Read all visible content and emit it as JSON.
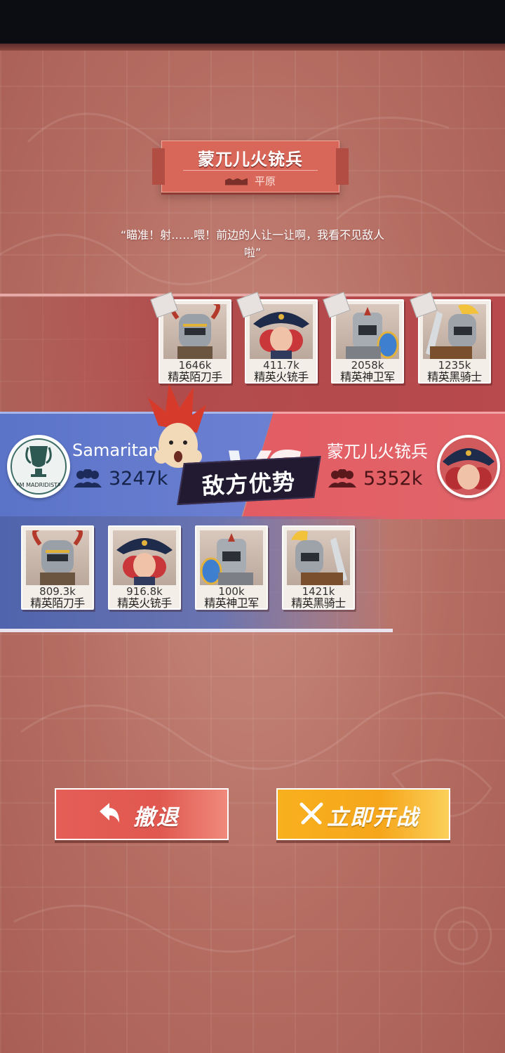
{
  "title": {
    "name": "蒙兀儿火铳兵",
    "terrain": "平原"
  },
  "quote": "“瞄准！射……喂！前边的人让一让啊，我看不见敌人啦”",
  "enemy_units": [
    {
      "power": "1646k",
      "name": "精英陌刀手"
    },
    {
      "power": "411.7k",
      "name": "精英火铳手"
    },
    {
      "power": "2058k",
      "name": "精英神卫军"
    },
    {
      "power": "1235k",
      "name": "精英黑骑士"
    }
  ],
  "ally_units": [
    {
      "power": "809.3k",
      "name": "精英陌刀手"
    },
    {
      "power": "916.8k",
      "name": "精英火铳手"
    },
    {
      "power": "100k",
      "name": "精英神卫军"
    },
    {
      "power": "1421k",
      "name": "精英黑骑士"
    }
  ],
  "ally": {
    "name": "Samaritan",
    "power": "3247k",
    "badge_text": "I'M MADRIDISTA"
  },
  "enemy": {
    "name": "蒙兀儿火铳兵",
    "power": "5352k"
  },
  "vs": {
    "text": "VS",
    "status": "敌方优势"
  },
  "buttons": {
    "retreat": "撤退",
    "fight": "立即开战"
  },
  "icons": [
    "users-icon",
    "retreat-arrow-icon",
    "swords-icon"
  ],
  "colors": {
    "ally": "#5b74c8",
    "enemy": "#e35c63",
    "retreat": "#e55e57",
    "fight": "#f8b01e"
  }
}
